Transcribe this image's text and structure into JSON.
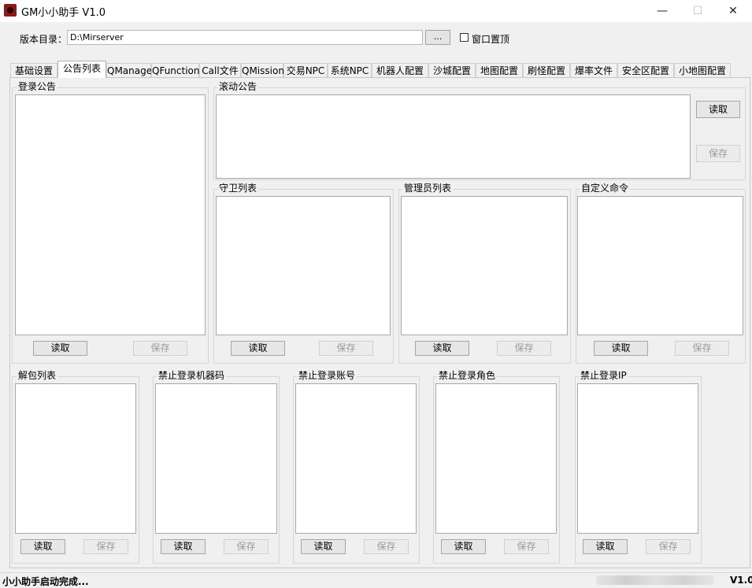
{
  "window": {
    "title": "GM小小助手 V1.0",
    "controls": {
      "minimize": "—",
      "maximize": "☐",
      "close": "✕"
    }
  },
  "toolbar": {
    "dir_label": "版本目录：",
    "dir_value": "D:\\Mirserver",
    "browse_label": "...",
    "topmost_label": "窗口置顶",
    "topmost_checked": false
  },
  "tabs": [
    {
      "label": "基础设置"
    },
    {
      "label": "公告列表",
      "active": true
    },
    {
      "label": "QManage"
    },
    {
      "label": "QFunction"
    },
    {
      "label": "Call文件"
    },
    {
      "label": "QMission"
    },
    {
      "label": "交易NPC"
    },
    {
      "label": "系统NPC"
    },
    {
      "label": "机器人配置"
    },
    {
      "label": "沙城配置"
    },
    {
      "label": "地图配置"
    },
    {
      "label": "刷怪配置"
    },
    {
      "label": "爆率文件"
    },
    {
      "label": "安全区配置"
    },
    {
      "label": "小地图配置"
    }
  ],
  "buttons": {
    "read": "读取",
    "save": "保存"
  },
  "groups": {
    "login_notice": "登录公告",
    "scroll_notice": "滚动公告",
    "guard_list": "守卫列表",
    "admin_list": "管理员列表",
    "custom_cmd": "自定义命令",
    "unpack_list": "解包列表",
    "ban_machine": "禁止登录机器码",
    "ban_account": "禁止登录账号",
    "ban_role": "禁止登录角色",
    "ban_ip": "禁止登录IP"
  },
  "status": {
    "message": "小小助手启动完成...",
    "version": "V1.0"
  }
}
